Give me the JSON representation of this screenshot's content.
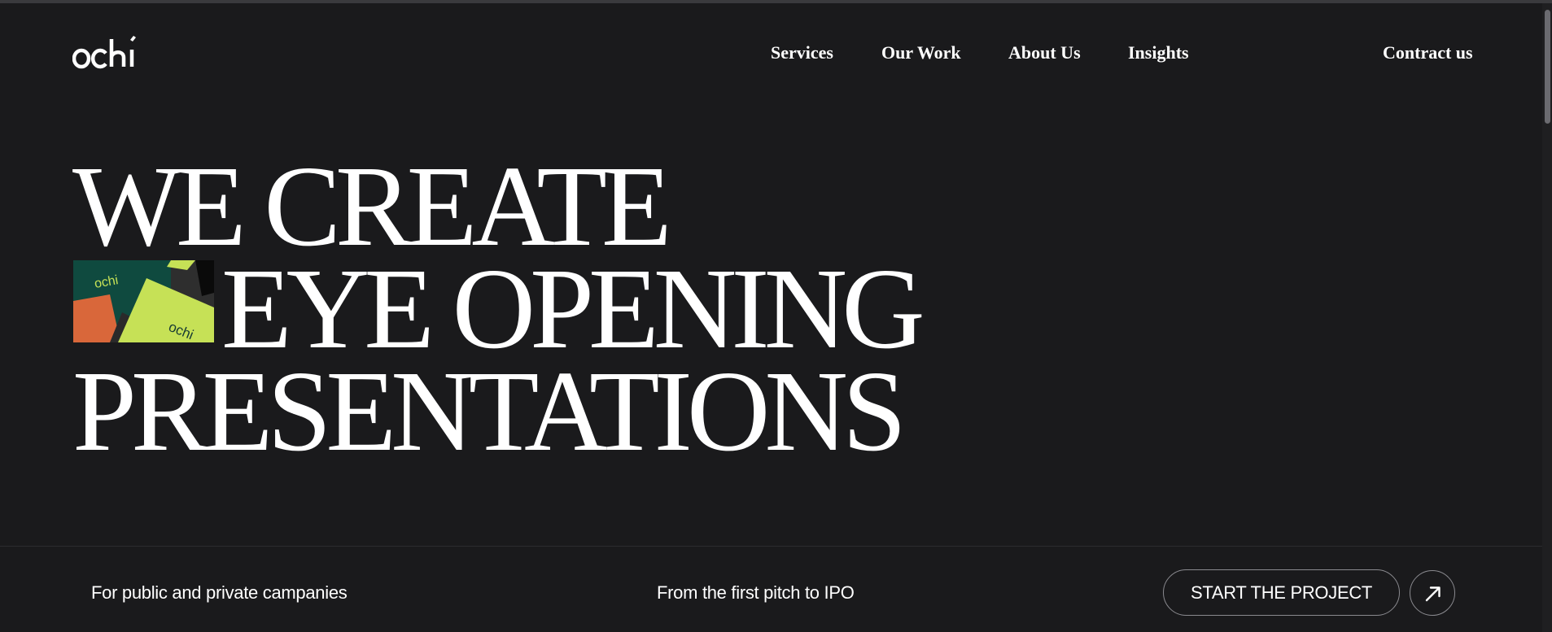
{
  "brand": {
    "logo_text": "ochi",
    "logo_icon": "ochi-logo"
  },
  "nav": {
    "items": [
      {
        "label": "Services"
      },
      {
        "label": "Our Work"
      },
      {
        "label": "About Us"
      },
      {
        "label": "Insights"
      }
    ],
    "contact_label": "Contract us"
  },
  "hero": {
    "line1": "WE CREATE",
    "line2": "EYE OPENING",
    "line3": "PRESENTATIONS",
    "thumbnail_brand_text": "ochi"
  },
  "footer": {
    "left_text": "For public and private campanies",
    "middle_text": "From the first pitch to IPO",
    "cta_label": "START THE PROJECT",
    "cta_icon": "arrow-up-right-icon"
  },
  "colors": {
    "background": "#1a1a1c",
    "text": "#ffffff",
    "thumb_green_dark": "#0f4a3f",
    "thumb_lime": "#c6e156",
    "thumb_orange": "#d9673a"
  }
}
